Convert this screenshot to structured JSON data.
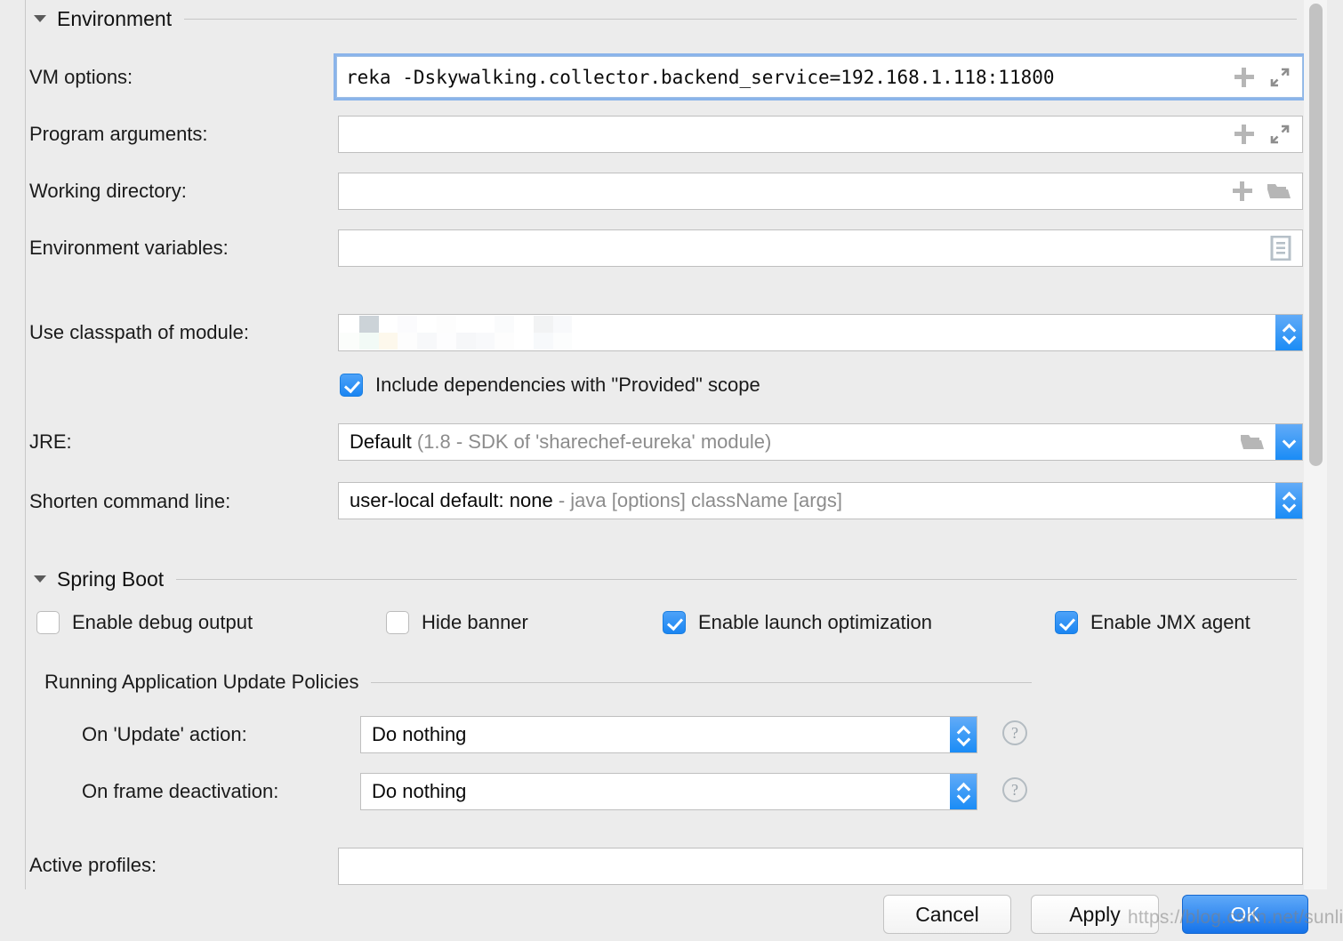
{
  "sections": {
    "environment": {
      "title": "Environment",
      "disclosure_icon": "triangle-down-icon"
    },
    "spring_boot": {
      "title": "Spring Boot",
      "disclosure_icon": "triangle-down-icon"
    },
    "update_policies": {
      "title": "Running Application Update Policies"
    }
  },
  "fields": {
    "vm_options": {
      "label": "VM options:",
      "value": "reka -Dskywalking.collector.backend_service=192.168.1.118:11800",
      "placeholder": "",
      "focused": true,
      "icons": [
        "plus-icon",
        "expand-icon"
      ]
    },
    "program_arguments": {
      "label": "Program arguments:",
      "value": "",
      "placeholder": "",
      "icons": [
        "plus-icon",
        "expand-icon"
      ]
    },
    "working_directory": {
      "label": "Working directory:",
      "value": "",
      "placeholder": "",
      "icons": [
        "plus-icon",
        "folder-icon"
      ]
    },
    "environment_variables": {
      "label": "Environment variables:",
      "value": "",
      "placeholder": "",
      "icons": [
        "list-document-icon"
      ]
    },
    "use_classpath_of_module": {
      "label": "Use classpath of module:",
      "value": "",
      "redacted": true,
      "spinner_icon": "spinner-updown-icon"
    },
    "include_provided_scope": {
      "label": "Include dependencies with \"Provided\" scope",
      "checked": true
    },
    "jre": {
      "label": "JRE:",
      "value": "Default",
      "value_detail": "(1.8 - SDK of 'sharechef-eureka' module)",
      "icons": [
        "folder-icon"
      ],
      "spinner_icon": "chevron-down-icon"
    },
    "shorten_command_line": {
      "label": "Shorten command line:",
      "value": "user-local default: none",
      "value_detail": "- java [options] className [args]",
      "spinner_icon": "spinner-updown-icon"
    },
    "active_profiles": {
      "label": "Active profiles:",
      "value": "",
      "placeholder": ""
    }
  },
  "spring_boot_options": [
    {
      "label": "Enable debug output",
      "checked": false
    },
    {
      "label": "Hide banner",
      "checked": false
    },
    {
      "label": "Enable launch optimization",
      "checked": true
    },
    {
      "label": "Enable JMX agent",
      "checked": true
    }
  ],
  "update_policies": [
    {
      "label": "On 'Update' action:",
      "value": "Do nothing",
      "help_icon": "question-mark-icon",
      "spinner_icon": "spinner-updown-icon"
    },
    {
      "label": "On frame deactivation:",
      "value": "Do nothing",
      "help_icon": "question-mark-icon",
      "spinner_icon": "spinner-updown-icon"
    }
  ],
  "buttons": {
    "cancel": "Cancel",
    "apply": "Apply",
    "ok": "OK"
  },
  "watermark": "https://blog.csdn.net/sunlihuo",
  "colors": {
    "background": "#ececec",
    "field_background": "#ffffff",
    "accent_blue": "#1a85f2",
    "focus_ring": "#8ab4ea",
    "muted_text": "#8c8c8c",
    "border": "#bfbfbf"
  }
}
